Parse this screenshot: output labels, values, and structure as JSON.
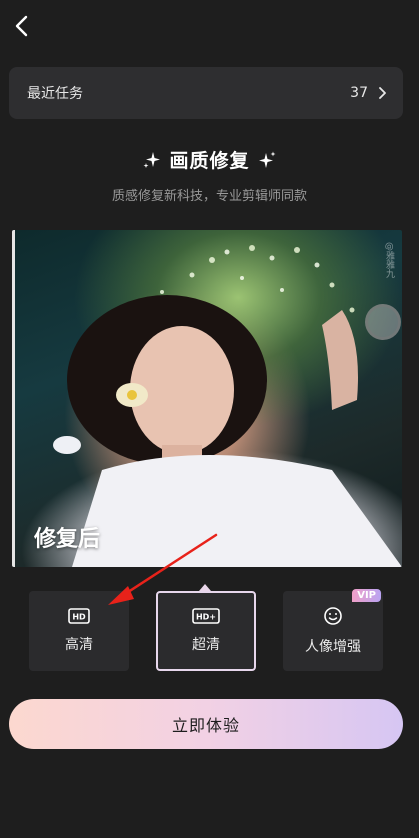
{
  "header": {
    "back_icon": "chevron-left-icon"
  },
  "recent_tasks": {
    "label": "最近任务",
    "count": "37",
    "chevron_icon": "chevron-right-icon"
  },
  "feature": {
    "title": "画质修复",
    "subtitle": "质感修复新科技，专业剪辑师同款",
    "sparkle_icon": "sparkle-icon"
  },
  "preview": {
    "after_label": "修复后",
    "watermark": "@雅雅九"
  },
  "options": [
    {
      "icon_text": "HD",
      "label": "高清",
      "icon": "hd-icon"
    },
    {
      "icon_text": "HD+",
      "label": "超清",
      "icon": "hd-plus-icon",
      "selected": true
    },
    {
      "icon_text": "",
      "label": "人像增强",
      "icon": "face-smile-icon",
      "badge": "VIP"
    }
  ],
  "cta": {
    "label": "立即体验"
  },
  "colors": {
    "background": "#1e1e1e",
    "card": "#2e2e30",
    "annotation_arrow": "#e8221a",
    "accent_start": "#fcd8cf",
    "accent_end": "#d6c6f3"
  }
}
